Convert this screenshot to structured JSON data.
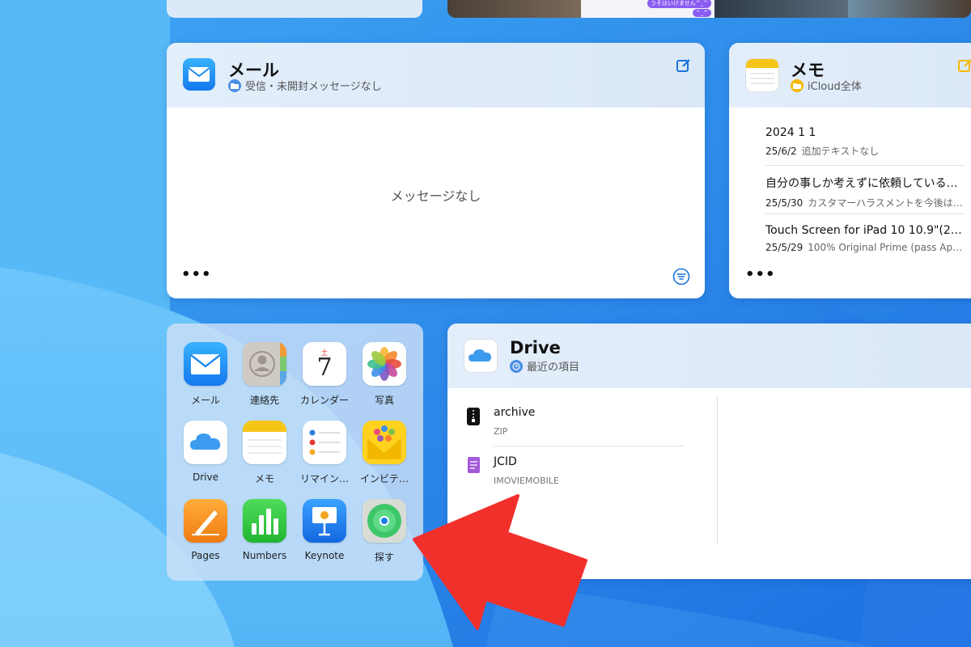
{
  "top_strip": {
    "chat_line_1": "うそはいけません^_^",
    "chat_line_2": "^_^"
  },
  "mail": {
    "title": "メール",
    "subtitle": "受信・未開封メッセージなし",
    "empty_text": "メッセージなし",
    "more": "•••"
  },
  "notes": {
    "title": "メモ",
    "subtitle": "iCloud全体",
    "more": "•••",
    "items": [
      {
        "title": "2024 1 1",
        "date": "25/6/2",
        "preview": "追加テキストなし"
      },
      {
        "title": "自分の事しか考えずに依頼している…",
        "date": "25/5/30",
        "preview": "カスタマーハラスメントを今後は…"
      },
      {
        "title": "Touch Screen for iPad 10 10.9\"(202…",
        "date": "25/5/29",
        "preview": "100% Original Prime (pass Appl…"
      }
    ]
  },
  "launcher": {
    "apps": [
      {
        "label": "メール",
        "icon": "mail-icon"
      },
      {
        "label": "連絡先",
        "icon": "contacts-icon"
      },
      {
        "label": "カレンダー",
        "icon": "calendar-icon",
        "day": "土",
        "date": "7"
      },
      {
        "label": "写真",
        "icon": "photos-icon"
      },
      {
        "label": "Drive",
        "icon": "icloud-drive-icon"
      },
      {
        "label": "メモ",
        "icon": "notes-icon"
      },
      {
        "label": "リマイン…",
        "icon": "reminders-icon"
      },
      {
        "label": "インビテ…",
        "icon": "invites-icon"
      },
      {
        "label": "Pages",
        "icon": "pages-icon"
      },
      {
        "label": "Numbers",
        "icon": "numbers-icon"
      },
      {
        "label": "Keynote",
        "icon": "keynote-icon"
      },
      {
        "label": "探す",
        "icon": "find-my-icon"
      }
    ]
  },
  "drive": {
    "title": "Drive",
    "subtitle": "最近の項目",
    "files": [
      {
        "name": "archive",
        "type": "ZIP",
        "icon": "zip-file-icon"
      },
      {
        "name": "JCID",
        "type": "IMOVIEMOBILE",
        "icon": "document-icon"
      }
    ]
  },
  "colors": {
    "accent": "#1a73d9",
    "notes_yellow": "#f5b800",
    "arrow_red": "#f2302b"
  }
}
